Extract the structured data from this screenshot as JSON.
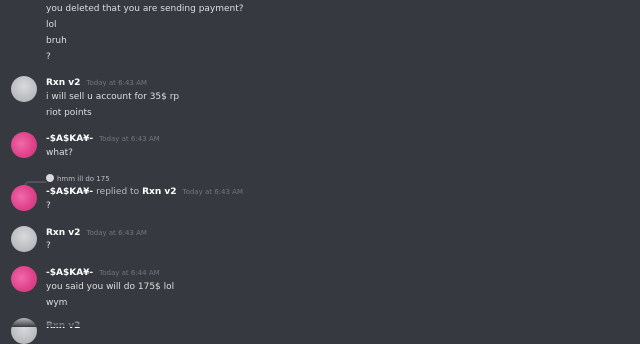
{
  "messages": {
    "top_lines": [
      "you deleted that you are sending payment?",
      "lol",
      "bruh",
      "?"
    ],
    "rxn1": {
      "author": "Rxn v2",
      "time": "Today at 6:43 AM",
      "lines": [
        "i will sell u account for 35$ rp",
        "riot points"
      ]
    },
    "saska1": {
      "author": "-$A$KA¥-",
      "time": "Today at 6:43 AM",
      "lines": [
        "what?"
      ]
    },
    "reply": {
      "ref_text": "hmm ill do 175",
      "author": "-$A$KA¥-",
      "replied_word": "replied to",
      "replied_to": "Rxn v2",
      "time": "Today at 6:43 AM",
      "lines": [
        "?"
      ]
    },
    "rxn2": {
      "author": "Rxn v2",
      "time": "Today at 6:43 AM",
      "lines": [
        "?"
      ]
    },
    "saska2": {
      "author": "-$A$KA¥-",
      "time": "Today at 6:44 AM",
      "lines": [
        "you said you will do 175$ lol",
        "wym"
      ]
    },
    "partial_author": "Rxn v2"
  }
}
